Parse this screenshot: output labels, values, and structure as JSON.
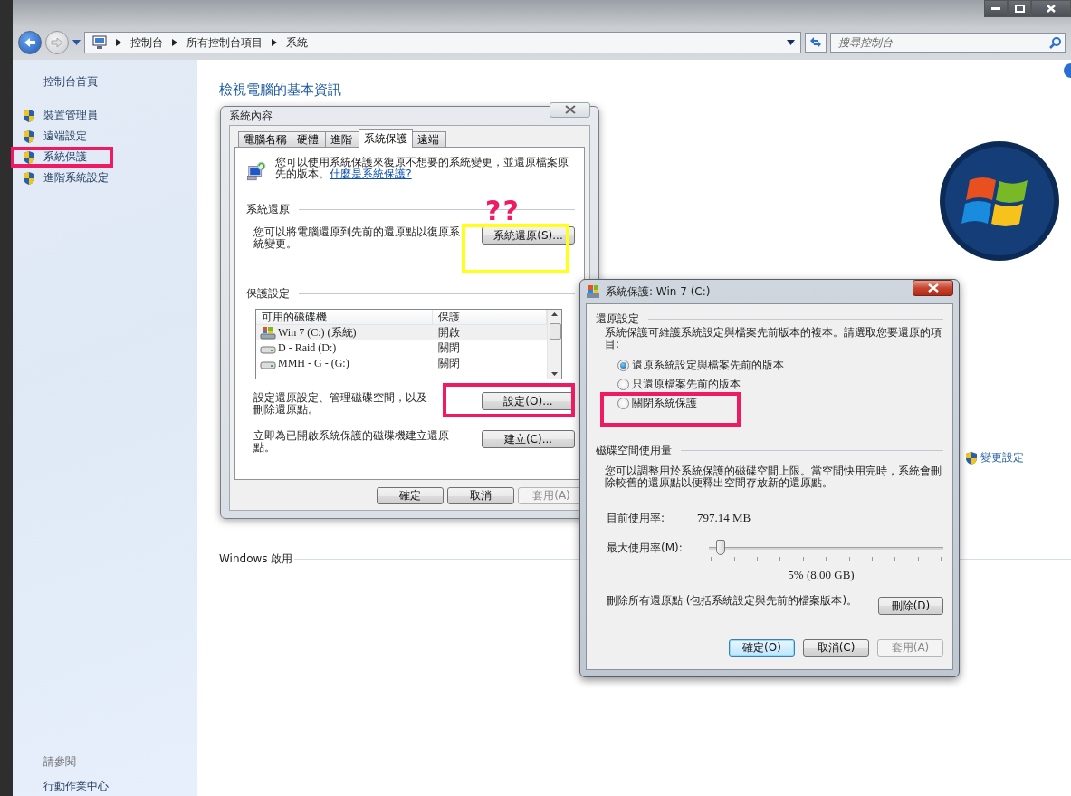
{
  "explorer": {
    "breadcrumbs": [
      "控制台",
      "所有控制台項目",
      "系統"
    ],
    "search": {
      "placeholder": "搜尋控制台"
    },
    "sidebar": {
      "home": "控制台首頁",
      "tasks": [
        {
          "label": "裝置管理員"
        },
        {
          "label": "遠端設定"
        },
        {
          "label": "系統保護"
        },
        {
          "label": "進階系統設定"
        }
      ],
      "see_also_title": "請參閱",
      "see_also": [
        "行動作業中心"
      ]
    },
    "main": {
      "heading": "檢視電腦的基本資訊",
      "change_settings": "變更設定",
      "activation_title": "Windows 啟用"
    }
  },
  "system_properties": {
    "title": "系統內容",
    "tabs": [
      {
        "label": "電腦名稱",
        "selected": false
      },
      {
        "label": "硬體",
        "selected": false
      },
      {
        "label": "進階",
        "selected": false
      },
      {
        "label": "系統保護",
        "selected": true
      },
      {
        "label": "遠端",
        "selected": false
      }
    ],
    "intro": "您可以使用系統保護來復原不想要的系統變更，並還原檔案原先的版本。",
    "intro_link": "什麼是系統保護?",
    "restore_section": "系統還原",
    "restore_text": "您可以將電腦還原到先前的還原點以復原系統變更。",
    "restore_button": "系統還原(S)...",
    "protection_section": "保護設定",
    "drives": {
      "columns": [
        "可用的磁碟機",
        "保護"
      ],
      "rows": [
        {
          "kind": "system",
          "name": "Win 7 (C:) (系統)",
          "protection": "開啟"
        },
        {
          "kind": "disk",
          "name": "D - Raid (D:)",
          "protection": "關閉"
        },
        {
          "kind": "disk",
          "name": "MMH - G - (G:)",
          "protection": "關閉"
        }
      ]
    },
    "configure_text": "設定還原設定、管理磁碟空間，以及刪除還原點。",
    "configure_button": "設定(O)...",
    "create_text": "立即為已開啟系統保護的磁碟機建立還原點。",
    "create_button": "建立(C)...",
    "buttons": [
      {
        "label": "確定",
        "disabled": false
      },
      {
        "label": "取消",
        "disabled": false
      },
      {
        "label": "套用(A)",
        "disabled": true
      }
    ]
  },
  "protection_dialog": {
    "title": "系統保護: Win 7 (C:)",
    "restore_section": "還原設定",
    "restore_text": "系統保護可維護系統設定與檔案先前版本的複本。請選取您要還原的項目:",
    "options": [
      {
        "label": "還原系統設定與檔案先前的版本",
        "selected": true
      },
      {
        "label": "只還原檔案先前的版本",
        "selected": false
      },
      {
        "label": "關閉系統保護",
        "selected": false
      }
    ],
    "disk_section": "磁碟空間使用量",
    "disk_text": "您可以調整用於系統保護的磁碟空間上限。當空間快用完時，系統會刪除較舊的還原點以便釋出空間存放新的還原點。",
    "current_label": "目前使用率:",
    "current_value": "797.14 MB",
    "max_label": "最大使用率(M):",
    "max_slider": {
      "level": 0.05
    },
    "max_value": "5% (8.00 GB)",
    "delete_text": "刪除所有還原點 (包括系統設定與先前的檔案版本)。",
    "delete_button": "刪除(D)",
    "buttons": [
      {
        "label": "確定(O)",
        "disabled": false,
        "default": true
      },
      {
        "label": "取消(C)",
        "disabled": false,
        "default": false
      },
      {
        "label": "套用(A)",
        "disabled": true,
        "default": false
      }
    ]
  },
  "annotations": [
    {
      "kind": "box",
      "color": "#f01a62"
    },
    {
      "kind": "box",
      "color": "#ffff1a"
    },
    {
      "kind": "text",
      "text": "??",
      "color": "#f01a62"
    },
    {
      "kind": "box",
      "color": "#f01a62"
    },
    {
      "kind": "box",
      "color": "#f01a62"
    }
  ]
}
